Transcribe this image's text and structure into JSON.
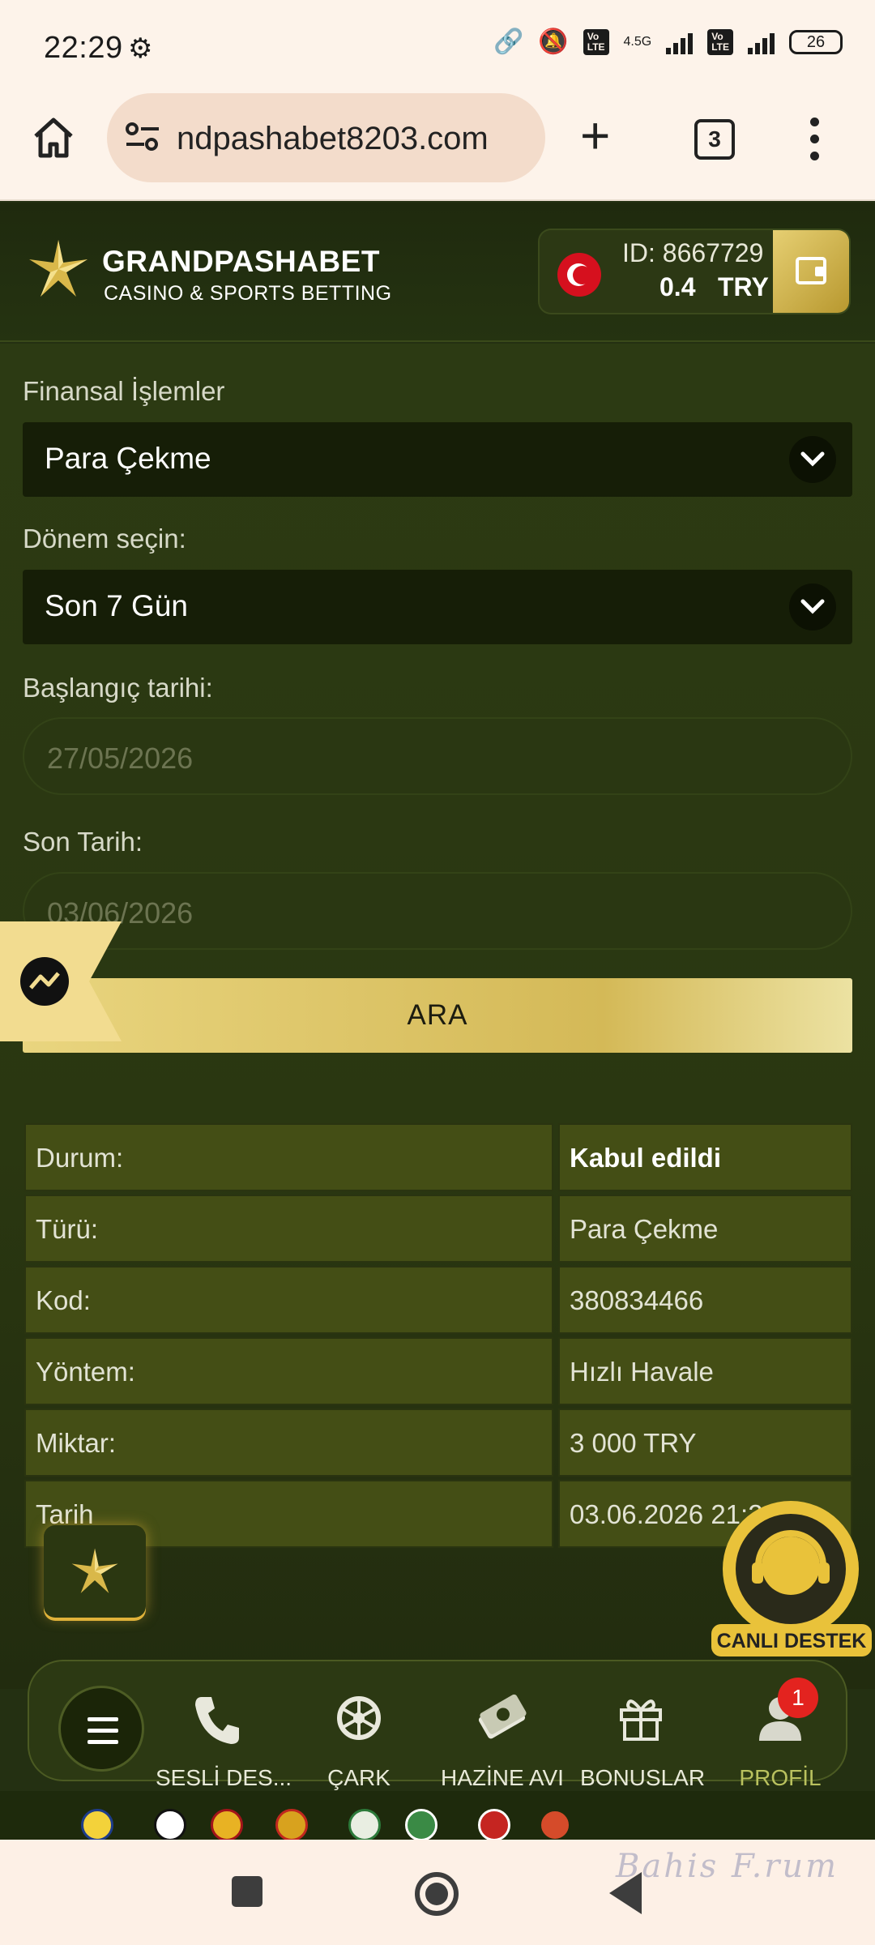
{
  "status_bar": {
    "time": "22:29",
    "network": "4.5G",
    "battery": "26"
  },
  "browser": {
    "url": "ndpashabet8203.com",
    "tab_count": "3"
  },
  "header": {
    "brand": "GRANDPASHABET",
    "tagline": "CASINO & SPORTS BETTING",
    "account_id": "ID: 8667729",
    "balance": "0.4",
    "currency": "TRY"
  },
  "form": {
    "type_label": "Finansal İşlemler",
    "type_value": "Para Çekme",
    "period_label": "Dönem seçin:",
    "period_value": "Son 7 Gün",
    "start_label": "Başlangıç tarihi:",
    "start_value": "27/05/2026",
    "end_label": "Son Tarih:",
    "end_value": "03/06/2026",
    "search_button": "ARA"
  },
  "result_table": [
    {
      "key": "Durum:",
      "value": "Kabul edildi"
    },
    {
      "key": "Türü:",
      "value": "Para Çekme"
    },
    {
      "key": "Kod:",
      "value": "380834466"
    },
    {
      "key": "Yöntem:",
      "value": "Hızlı Havale"
    },
    {
      "key": "Miktar:",
      "value": "3 000 TRY"
    },
    {
      "key": "Tarih",
      "value": "03.06.2026 21:2"
    }
  ],
  "live_support": "CANLI DESTEK",
  "bottom_nav": {
    "items": [
      {
        "label": "SESLİ DES...",
        "icon": "phone-icon"
      },
      {
        "label": "ÇARK",
        "icon": "wheel-icon"
      },
      {
        "label": "HAZİNE AVI",
        "icon": "treasure-icon"
      },
      {
        "label": "BONUSLAR",
        "icon": "gift-icon"
      },
      {
        "label": "PROFİL",
        "icon": "profile-icon",
        "badge": "1"
      }
    ]
  },
  "watermark": "Bahis F.rum",
  "colors": {
    "accent_gold": "#d4b957",
    "background": "#2c3a13",
    "active_nav": "#b9c15e"
  }
}
